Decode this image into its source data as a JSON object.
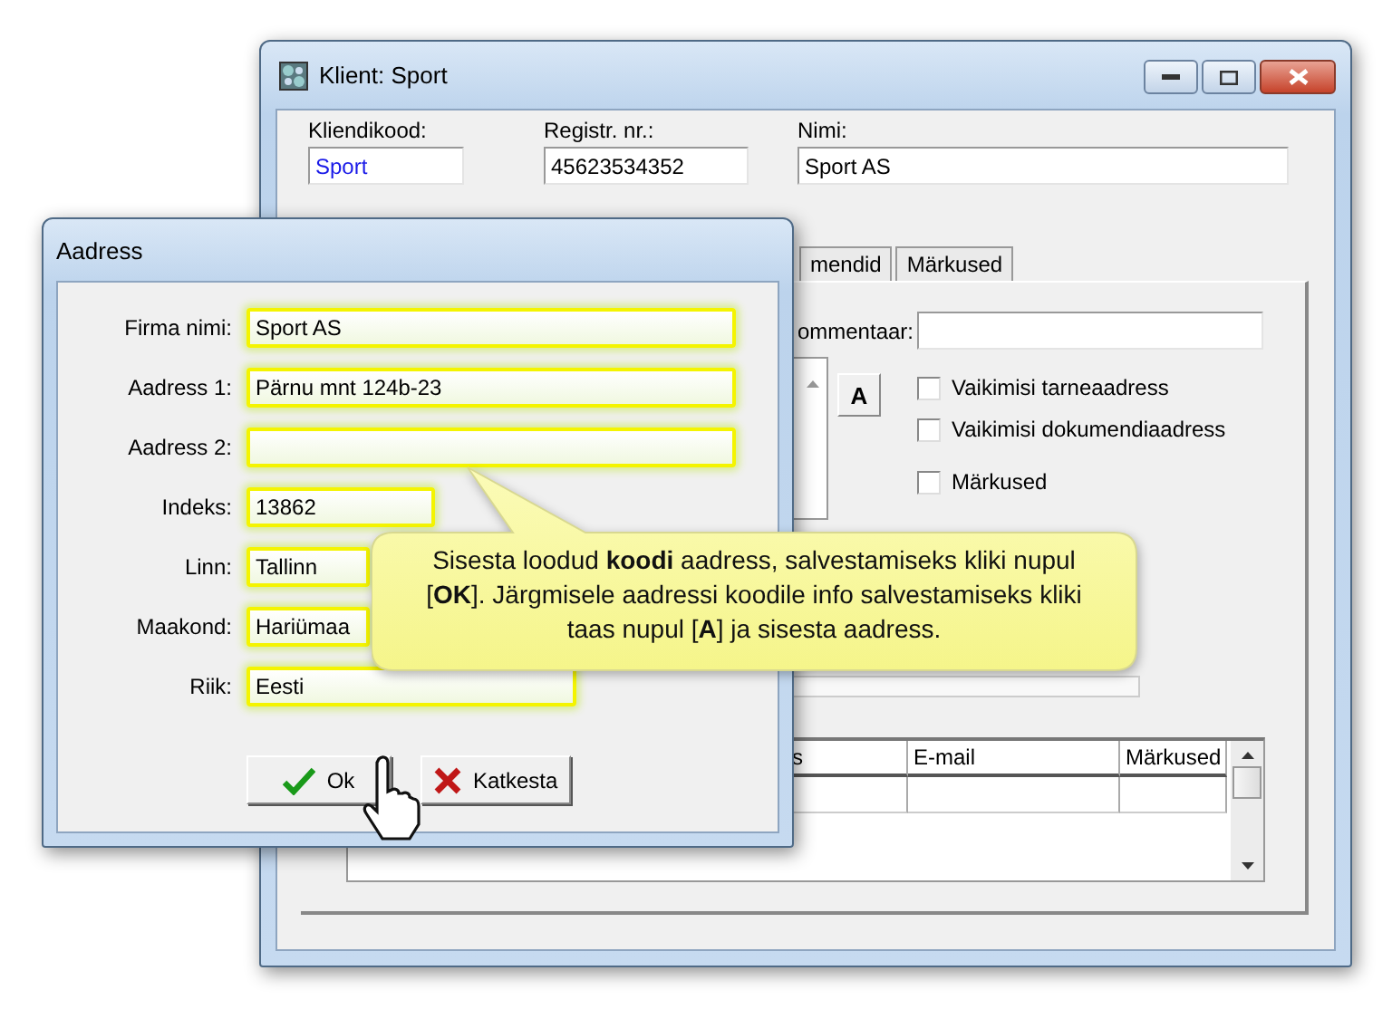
{
  "client_window": {
    "title": "Klient: Sport",
    "fields": [
      {
        "label": "Kliendikood:",
        "value": "Sport"
      },
      {
        "label": "Registr. nr.:",
        "value": "45623534352"
      },
      {
        "label": "Nimi:",
        "value": "Sport AS"
      }
    ],
    "tabs": [
      {
        "label": "mendid",
        "selected": false
      },
      {
        "label": "Märkused",
        "selected": false
      }
    ],
    "comment_label": "ommentaar:",
    "address_button": "A",
    "checkboxes": [
      {
        "label": "Vaikimisi tarneaadress",
        "checked": false
      },
      {
        "label": "Vaikimisi dokumendiaadress",
        "checked": false
      },
      {
        "label": "Märkused",
        "checked": false
      }
    ],
    "table": {
      "columns": [
        "s",
        "E-mail",
        "Märkused"
      ]
    }
  },
  "address_dialog": {
    "title": "Aadress",
    "fields": [
      {
        "label": "Firma nimi:",
        "value": "Sport AS"
      },
      {
        "label": "Aadress 1:",
        "value": "Pärnu mnt 124b-23"
      },
      {
        "label": "Aadress 2:"
      },
      {
        "label": "Indeks:",
        "value": "13862"
      },
      {
        "label": "Linn:",
        "value": "Tallinn"
      },
      {
        "label": "Maakond:",
        "value": "Hariümaa"
      },
      {
        "label": "Riik:",
        "value": "Eesti"
      }
    ],
    "buttons": [
      {
        "label": "Ok",
        "kind": "ok"
      },
      {
        "label": "Katkesta",
        "kind": "cancel"
      }
    ]
  },
  "callout": {
    "text": "Sisesta loodud **koodi** aadress, salvestamiseks kliki nupul [**OK**]. Järgmisele aadressi koodile info salvestamiseks kliki taas nupul [**A**] ja sisesta aadress."
  }
}
